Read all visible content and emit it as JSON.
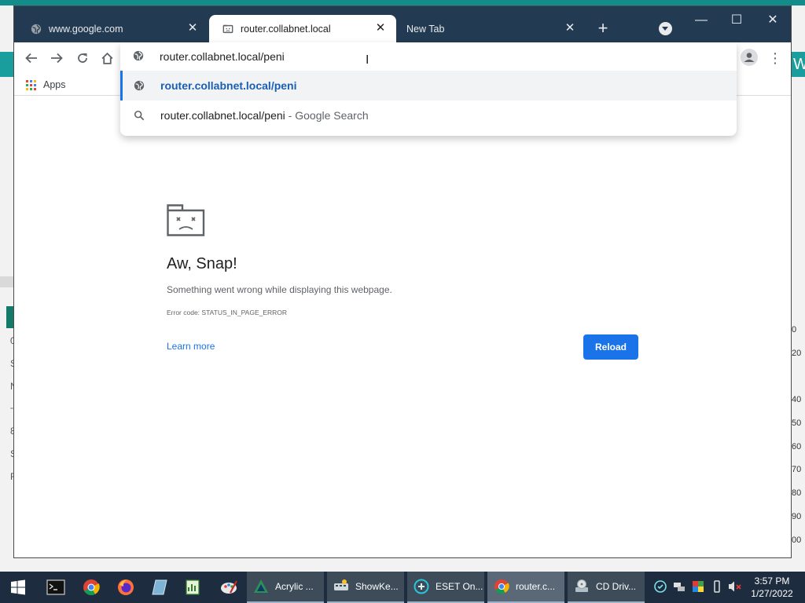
{
  "background": {
    "right_edge_numbers": [
      "0",
      "20",
      "40",
      "50",
      "60",
      "70",
      "80",
      "90",
      "00"
    ],
    "left_edge_chars": [
      "0",
      "S",
      "N",
      "-",
      "8",
      "S",
      "F"
    ],
    "right_edge_heading": "W"
  },
  "tabs": [
    {
      "title": "www.google.com",
      "icon": "globe-icon",
      "active": false
    },
    {
      "title": "router.collabnet.local",
      "icon": "sad-tab-icon",
      "active": true
    },
    {
      "title": "New Tab",
      "icon": "none",
      "active": false
    }
  ],
  "window_controls": {
    "minimize": "—",
    "maximize": "☐",
    "close": "✕"
  },
  "new_tab_symbol": "+",
  "omnibox": {
    "value": "router.collabnet.local/peni",
    "suggestions": [
      {
        "icon": "globe-icon",
        "text": "router.collabnet.local/peni"
      },
      {
        "icon": "search-icon",
        "query": "router.collabnet.local/peni",
        "separator": " - ",
        "provider": "Google Search"
      }
    ]
  },
  "bookmarks": {
    "apps_label": "Apps"
  },
  "error_page": {
    "title": "Aw, Snap!",
    "message": "Something went wrong while displaying this webpage.",
    "error_code": "Error code: STATUS_IN_PAGE_ERROR",
    "learn_more": "Learn more",
    "reload": "Reload"
  },
  "taskbar": {
    "apps": [
      {
        "label": "Acrylic ...",
        "icon": "acrylic-icon"
      },
      {
        "label": "ShowKe...",
        "icon": "showkeys-icon"
      },
      {
        "label": "ESET On...",
        "icon": "eset-icon"
      },
      {
        "label": "router.c...",
        "icon": "chrome-icon",
        "active": true
      },
      {
        "label": "CD Driv...",
        "icon": "cd-drive-icon"
      }
    ],
    "clock": {
      "time": "3:57 PM",
      "date": "1/27/2022"
    }
  },
  "colors": {
    "accent": "#1a73e8",
    "titlebar": "#233b52",
    "taskbar": "#1d2d3f"
  }
}
